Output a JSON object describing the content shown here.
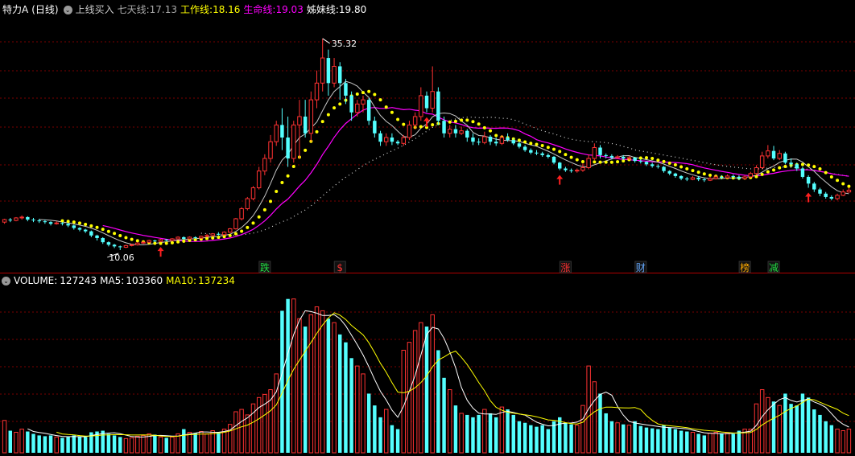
{
  "header": {
    "stock_name": "特力A",
    "period": "(日线)",
    "indicator_name": "上线买入",
    "lines": [
      {
        "label": "七天线:",
        "value": "17.13",
        "color": "#a8a8a8"
      },
      {
        "label": "工作线:",
        "value": "18.16",
        "color": "#ffff00"
      },
      {
        "label": "生命线:",
        "value": "19.03",
        "color": "#ff00ff"
      },
      {
        "label": "姊妹线:",
        "value": "19.80",
        "color": "#ffffff"
      }
    ]
  },
  "volume_header": {
    "title": "VOLUME:",
    "value": "127243",
    "ma5_label": "MA5:",
    "ma5_value": "103360",
    "ma10_label": "MA10:",
    "ma10_value": "137234"
  },
  "colors": {
    "up": "#ff3232",
    "down": "#54ffff",
    "grid": "#7a0000",
    "work": "#ffff00",
    "life": "#ff00ff",
    "seven": "#c8c8c8",
    "sister": "#ffffff"
  },
  "annotations": {
    "high_label": "35.32",
    "low_label": "10.06"
  },
  "chart_data": {
    "type": "candlestick",
    "price_ylim": [
      9,
      38
    ],
    "volume_ylim": [
      0,
      210000
    ],
    "candles": [
      [
        13.4,
        13.7,
        13.8,
        13.2,
        41000
      ],
      [
        13.7,
        13.6,
        13.9,
        13.4,
        28000
      ],
      [
        13.6,
        13.9,
        14.0,
        13.5,
        26000
      ],
      [
        13.9,
        14.0,
        14.2,
        13.7,
        30000
      ],
      [
        14.0,
        13.7,
        14.1,
        13.5,
        27000
      ],
      [
        13.7,
        13.6,
        13.9,
        13.4,
        24000
      ],
      [
        13.6,
        13.5,
        13.8,
        13.3,
        22000
      ],
      [
        13.5,
        13.4,
        13.7,
        13.2,
        21000
      ],
      [
        13.4,
        13.2,
        13.5,
        13.0,
        22000
      ],
      [
        13.2,
        13.3,
        13.5,
        13.1,
        20000
      ],
      [
        13.3,
        13.2,
        13.4,
        13.0,
        19000
      ],
      [
        13.2,
        13.0,
        13.3,
        12.8,
        20000
      ],
      [
        13.0,
        12.7,
        13.1,
        12.5,
        22000
      ],
      [
        12.7,
        12.5,
        12.8,
        12.3,
        21000
      ],
      [
        12.5,
        12.3,
        12.6,
        12.1,
        20000
      ],
      [
        12.3,
        11.8,
        12.4,
        11.6,
        26000
      ],
      [
        11.8,
        11.5,
        11.9,
        11.2,
        27000
      ],
      [
        11.5,
        11.0,
        11.6,
        10.8,
        28000
      ],
      [
        11.0,
        10.7,
        11.1,
        10.5,
        24000
      ],
      [
        10.7,
        10.5,
        10.8,
        10.3,
        22000
      ],
      [
        10.5,
        10.4,
        10.6,
        10.06,
        20000
      ],
      [
        10.4,
        10.6,
        10.7,
        10.3,
        18000
      ],
      [
        10.6,
        10.7,
        10.8,
        10.5,
        19000
      ],
      [
        10.7,
        10.9,
        11.0,
        10.6,
        21000
      ],
      [
        10.9,
        11.0,
        11.1,
        10.8,
        22000
      ],
      [
        11.0,
        11.2,
        11.3,
        10.9,
        24000
      ],
      [
        11.2,
        11.1,
        11.3,
        11.0,
        23000
      ],
      [
        11.1,
        11.3,
        11.4,
        11.0,
        20000
      ],
      [
        11.3,
        11.2,
        11.4,
        11.1,
        19000
      ],
      [
        11.2,
        11.4,
        11.5,
        11.1,
        20000
      ],
      [
        11.4,
        11.6,
        11.7,
        11.3,
        24000
      ],
      [
        11.6,
        11.4,
        11.7,
        11.3,
        30000
      ],
      [
        11.4,
        11.6,
        11.7,
        11.3,
        26000
      ],
      [
        11.6,
        11.5,
        11.7,
        11.4,
        25000
      ],
      [
        11.5,
        11.7,
        11.8,
        11.4,
        27000
      ],
      [
        11.7,
        11.8,
        12.0,
        11.6,
        24000
      ],
      [
        11.8,
        12.0,
        12.1,
        11.7,
        28000
      ],
      [
        12.0,
        11.9,
        12.2,
        11.8,
        26000
      ],
      [
        11.9,
        12.2,
        12.3,
        11.8,
        30000
      ],
      [
        12.2,
        12.6,
        12.7,
        12.1,
        36000
      ],
      [
        12.6,
        13.8,
        13.9,
        12.5,
        52000
      ],
      [
        13.8,
        15.0,
        15.2,
        13.6,
        55000
      ],
      [
        15.0,
        16.2,
        16.4,
        14.8,
        48000
      ],
      [
        16.2,
        17.5,
        17.7,
        16.0,
        62000
      ],
      [
        17.5,
        19.5,
        20.0,
        17.3,
        70000
      ],
      [
        19.5,
        21.0,
        21.5,
        19.0,
        74000
      ],
      [
        21.0,
        23.0,
        23.8,
        20.5,
        80000
      ],
      [
        23.0,
        25.0,
        25.5,
        22.5,
        100000
      ],
      [
        25.0,
        23.5,
        27.0,
        22.0,
        180000
      ],
      [
        23.5,
        21.0,
        26.0,
        20.0,
        195000
      ],
      [
        21.0,
        25.0,
        25.5,
        20.5,
        195000
      ],
      [
        25.0,
        26.0,
        28.0,
        21.0,
        170000
      ],
      [
        26.0,
        24.0,
        28.0,
        23.5,
        160000
      ],
      [
        24.0,
        28.0,
        29.0,
        23.0,
        175000
      ],
      [
        28.0,
        30.0,
        31.5,
        27.0,
        185000
      ],
      [
        30.0,
        33.0,
        35.32,
        29.0,
        180000
      ],
      [
        33.0,
        30.0,
        34.0,
        28.5,
        170000
      ],
      [
        30.0,
        32.0,
        33.0,
        29.5,
        165000
      ],
      [
        32.0,
        30.0,
        32.5,
        28.0,
        150000
      ],
      [
        30.0,
        28.5,
        30.5,
        27.5,
        140000
      ],
      [
        28.5,
        26.5,
        29.0,
        25.5,
        120000
      ],
      [
        26.5,
        27.5,
        28.0,
        26.0,
        110000
      ],
      [
        27.5,
        28.0,
        28.5,
        26.5,
        100000
      ],
      [
        28.0,
        25.5,
        28.2,
        25.0,
        75000
      ],
      [
        25.5,
        24.0,
        26.0,
        23.5,
        60000
      ],
      [
        24.0,
        23.0,
        24.3,
        22.5,
        45000
      ],
      [
        23.0,
        23.5,
        24.0,
        22.5,
        55000
      ],
      [
        23.5,
        23.0,
        24.0,
        22.6,
        35000
      ],
      [
        23.0,
        22.8,
        23.2,
        22.6,
        30000
      ],
      [
        22.8,
        23.5,
        23.8,
        22.5,
        130000
      ],
      [
        23.5,
        25.0,
        25.5,
        23.2,
        140000
      ],
      [
        25.0,
        26.0,
        26.5,
        24.5,
        155000
      ],
      [
        26.0,
        28.5,
        29.5,
        25.5,
        165000
      ],
      [
        28.5,
        27.0,
        29.0,
        26.5,
        160000
      ],
      [
        27.0,
        29.0,
        32.0,
        26.5,
        175000
      ],
      [
        29.0,
        25.5,
        29.5,
        25.0,
        130000
      ],
      [
        25.5,
        24.0,
        26.0,
        23.5,
        95000
      ],
      [
        24.0,
        24.5,
        25.0,
        23.5,
        80000
      ],
      [
        24.5,
        24.0,
        25.0,
        23.5,
        60000
      ],
      [
        24.0,
        24.3,
        24.8,
        23.8,
        50000
      ],
      [
        24.3,
        23.5,
        24.5,
        23.0,
        48000
      ],
      [
        23.5,
        23.0,
        24.0,
        22.6,
        45000
      ],
      [
        23.0,
        22.9,
        23.4,
        22.6,
        48000
      ],
      [
        22.9,
        23.6,
        24.2,
        22.7,
        55000
      ],
      [
        23.6,
        23.0,
        23.8,
        22.6,
        50000
      ],
      [
        23.0,
        22.8,
        23.5,
        22.5,
        45000
      ],
      [
        22.8,
        23.5,
        23.8,
        22.6,
        58000
      ],
      [
        23.5,
        23.2,
        24.0,
        23.0,
        55000
      ],
      [
        23.2,
        22.8,
        23.4,
        22.6,
        48000
      ],
      [
        22.8,
        22.4,
        23.0,
        22.2,
        40000
      ],
      [
        22.4,
        22.0,
        22.6,
        21.8,
        38000
      ],
      [
        22.0,
        21.7,
        22.2,
        21.5,
        35000
      ],
      [
        21.7,
        21.6,
        22.0,
        21.4,
        33000
      ],
      [
        21.6,
        21.4,
        21.8,
        21.2,
        35000
      ],
      [
        21.4,
        21.2,
        21.6,
        21.0,
        30000
      ],
      [
        21.2,
        20.5,
        21.3,
        20.3,
        40000
      ],
      [
        20.5,
        19.8,
        20.6,
        19.6,
        45000
      ],
      [
        19.8,
        19.6,
        20.0,
        19.4,
        38000
      ],
      [
        19.6,
        19.5,
        19.8,
        19.3,
        36000
      ],
      [
        19.5,
        19.6,
        19.8,
        19.3,
        35000
      ],
      [
        19.6,
        19.9,
        20.4,
        19.4,
        60000
      ],
      [
        19.9,
        21.0,
        21.5,
        19.7,
        110000
      ],
      [
        21.0,
        22.3,
        22.8,
        20.8,
        90000
      ],
      [
        22.3,
        21.4,
        22.6,
        21.0,
        75000
      ],
      [
        21.4,
        21.3,
        21.6,
        21.0,
        50000
      ],
      [
        21.3,
        21.1,
        21.5,
        20.9,
        40000
      ],
      [
        21.1,
        21.2,
        21.4,
        20.9,
        38000
      ],
      [
        21.2,
        21.0,
        21.4,
        20.8,
        36000
      ],
      [
        21.0,
        21.1,
        21.3,
        20.8,
        35000
      ],
      [
        21.1,
        20.7,
        21.2,
        20.5,
        40000
      ],
      [
        20.7,
        20.6,
        20.9,
        20.4,
        34000
      ],
      [
        20.6,
        20.3,
        20.7,
        20.1,
        32000
      ],
      [
        20.3,
        20.1,
        20.5,
        19.9,
        31000
      ],
      [
        20.1,
        20.0,
        20.3,
        19.8,
        30000
      ],
      [
        20.0,
        19.5,
        20.1,
        19.3,
        35000
      ],
      [
        19.5,
        19.2,
        19.6,
        19.0,
        32000
      ],
      [
        19.2,
        18.9,
        19.3,
        18.7,
        30000
      ],
      [
        18.9,
        18.6,
        19.0,
        18.4,
        28000
      ],
      [
        18.6,
        18.5,
        18.8,
        18.3,
        27000
      ],
      [
        18.5,
        18.7,
        18.9,
        18.4,
        26000
      ],
      [
        18.7,
        18.5,
        18.9,
        18.3,
        24000
      ],
      [
        18.5,
        18.4,
        18.7,
        18.2,
        22000
      ],
      [
        18.4,
        18.6,
        18.8,
        18.3,
        25000
      ],
      [
        18.6,
        18.8,
        19.0,
        18.5,
        26000
      ],
      [
        18.8,
        18.7,
        19.0,
        18.5,
        24000
      ],
      [
        18.7,
        18.9,
        19.1,
        18.6,
        25000
      ],
      [
        18.9,
        18.8,
        19.1,
        18.6,
        24000
      ],
      [
        18.8,
        18.6,
        19.0,
        18.4,
        28000
      ],
      [
        18.6,
        18.8,
        19.0,
        18.5,
        30000
      ],
      [
        18.8,
        19.2,
        19.4,
        18.7,
        30000
      ],
      [
        19.2,
        19.9,
        20.2,
        19.0,
        62000
      ],
      [
        19.9,
        21.3,
        21.8,
        19.7,
        80000
      ],
      [
        21.3,
        21.9,
        22.6,
        21.0,
        70000
      ],
      [
        21.9,
        21.0,
        22.5,
        20.8,
        65000
      ],
      [
        21.0,
        21.6,
        22.0,
        20.8,
        60000
      ],
      [
        21.6,
        20.5,
        21.8,
        20.3,
        75000
      ],
      [
        20.5,
        20.3,
        21.0,
        20.0,
        62000
      ],
      [
        20.3,
        19.8,
        20.5,
        19.5,
        60000
      ],
      [
        19.8,
        18.8,
        20.0,
        18.6,
        75000
      ],
      [
        18.8,
        18.0,
        19.0,
        17.5,
        70000
      ],
      [
        18.0,
        17.3,
        18.2,
        17.0,
        55000
      ],
      [
        17.3,
        16.8,
        17.5,
        16.5,
        48000
      ],
      [
        16.8,
        16.4,
        17.0,
        16.2,
        40000
      ],
      [
        16.4,
        16.2,
        16.6,
        16.0,
        35000
      ],
      [
        16.2,
        16.6,
        16.8,
        16.0,
        30000
      ],
      [
        16.6,
        17.0,
        17.3,
        16.5,
        28000
      ],
      [
        17.0,
        17.2,
        17.5,
        16.9,
        30000
      ]
    ],
    "arrows": [
      27,
      73,
      96,
      139
    ],
    "labels": [
      {
        "i": 45,
        "text": "跌",
        "color": "#22dd44"
      },
      {
        "i": 58,
        "text": "$",
        "color": "#ff3232"
      },
      {
        "i": 97,
        "text": "涨",
        "color": "#ff3232"
      },
      {
        "i": 110,
        "text": "财",
        "color": "#66aaff"
      },
      {
        "i": 128,
        "text": "榜",
        "color": "#ffaa00"
      },
      {
        "i": 133,
        "text": "减",
        "color": "#22dd44"
      }
    ]
  }
}
